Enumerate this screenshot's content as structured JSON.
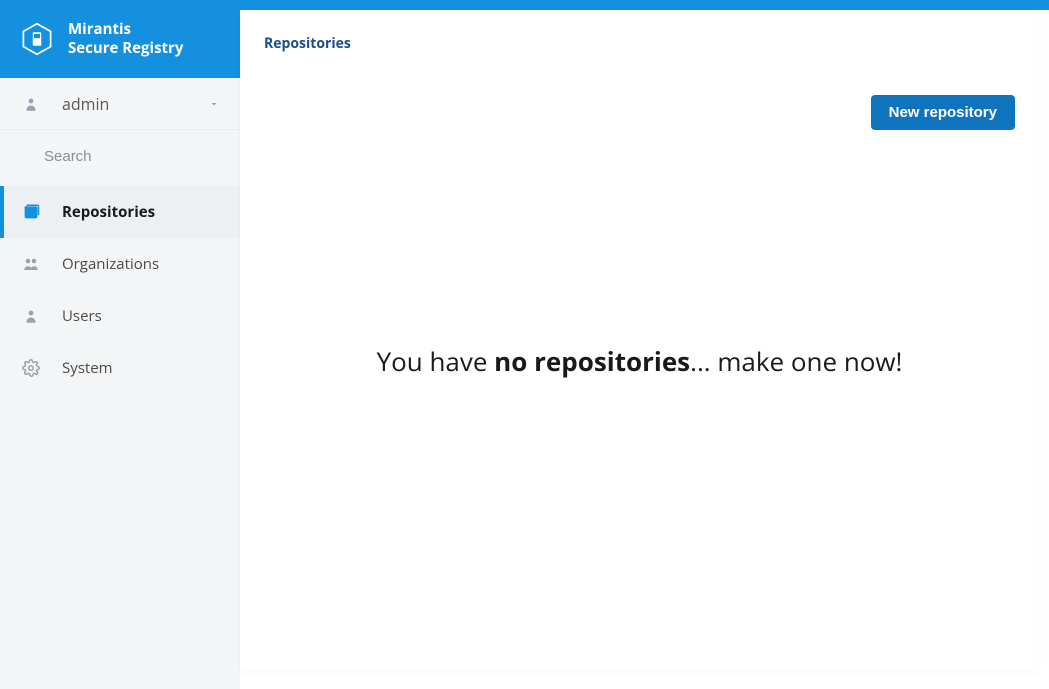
{
  "brand": {
    "line1": "Mirantis",
    "line2": "Secure Registry"
  },
  "user": {
    "name": "admin"
  },
  "search": {
    "placeholder": "Search"
  },
  "nav": {
    "repositories": "Repositories",
    "organizations": "Organizations",
    "users": "Users",
    "system": "System"
  },
  "breadcrumb": {
    "current": "Repositories"
  },
  "actions": {
    "new_repository": "New repository"
  },
  "empty_state": {
    "prefix": "You have ",
    "bold": "no repositories",
    "suffix": "... make one now!"
  }
}
